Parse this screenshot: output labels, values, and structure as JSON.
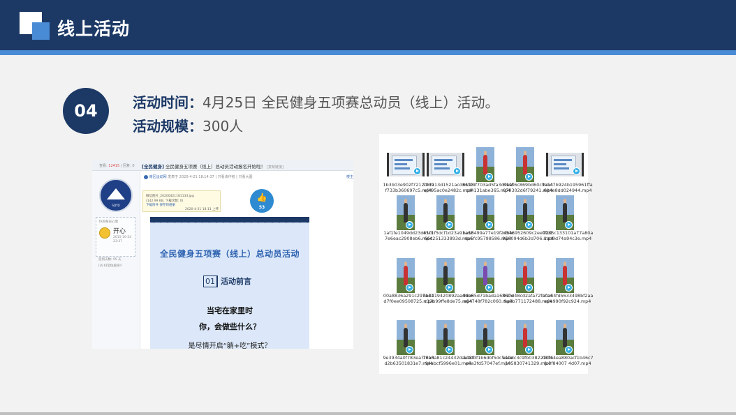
{
  "header": {
    "title": "线上活动"
  },
  "section": {
    "number": "04",
    "time_label": "活动时间：",
    "time_value": "4月25日  全民健身五项赛总动员（线上）活动。",
    "scale_label": "活动规模：",
    "scale_value": "300人"
  },
  "forum": {
    "stats_views_label": "查看:",
    "stats_views": "12415",
    "stats_replies": "| 回复: 0",
    "thread_tag": "[全民健身]",
    "thread_title": "全民健身五项赛（线上）总动员活动报名开始啦！",
    "thread_copy": "[复制链接]",
    "post_author": "南区运动网",
    "post_time": "发表于 2020-4-21 18:14:37",
    "post_links": "| 只看该作者 | 只看大图",
    "post_right": "楼主",
    "logo_text": "SQYD",
    "mood_title": "TA的每日心情",
    "mood_word": "开心",
    "mood_date": "2015-10-24 23:37",
    "stat1": "签到天数: 95 天",
    "stat2": "[LV.6]常住居民II",
    "attach_name": "微信图片_20200421181133.jpg",
    "attach_size": "(142.99 KB, 下载次数: 0)",
    "attach_links": "下载附件  保存到相册",
    "attach_time": "2020-4-21 18:11 上传",
    "like_icon": "👍",
    "like_count": "53",
    "poster_title": "全民健身五项赛（线上）总动员活动",
    "poster_section_num": "01",
    "poster_section": "活动前言",
    "poster_q1": "当宅在家里时",
    "poster_q2": "你，会做些什么？",
    "poster_q3": "是尽情开启“躺+吃”模式？"
  },
  "files": [
    {
      "name": "1b3b03e902f7212cf09f733b360697c5.mp4",
      "kind": "screen"
    },
    {
      "name": "7b3113d1521acd8613ef495ac0e2482c.mp4",
      "kind": "screen"
    },
    {
      "name": "61f0df703ad5fa3d7eafcd4131abe365.mp4",
      "kind": "red"
    },
    {
      "name": "84456c869bd60c9a54070302d6f79241.mp4",
      "kind": "red"
    },
    {
      "name": "fea47b924b195961ffa604e8dd024944.mp4",
      "kind": "screen"
    },
    {
      "name": "1af1fe1049dd23d61f97e6eac2908eb6.mp4",
      "kind": "dark"
    },
    {
      "name": "45c1f5dcf1d23a91a6b66c251333893d.mp4",
      "kind": "dark"
    },
    {
      "name": "ba18499a77e19f24bfeda5fc95798586.mp4",
      "kind": "dark"
    },
    {
      "name": "d546952609c2ee9fb1950094d6b3d706.mp4",
      "kind": "dark"
    },
    {
      "name": "ff285c133101a77a80a1dd9d74a94c3e.mp4",
      "kind": "dark"
    },
    {
      "name": "00a8836a291c297a41d7f0ee09508725.mp4",
      "kind": "red"
    },
    {
      "name": "0b3419420892aadbb6c12b99ffe8de75.mp4",
      "kind": "dark"
    },
    {
      "name": "94e85d71bada1686bea64748f782c060.mp4",
      "kind": "purple"
    },
    {
      "name": "917d48cd2afa72faca69a0b771172488.mp4",
      "kind": "red"
    },
    {
      "name": "c0a44fd5633498bf2aae0e990f92c924.mp4",
      "kind": "red"
    },
    {
      "name": "9e3934a0f783ea7f3bdd2b63501831e7.mp4",
      "kind": "dark"
    },
    {
      "name": "76a8a81c24432daeccf94abcf5996e01.mp4",
      "kind": "dark"
    },
    {
      "name": "148fdf1b6dbf5dc541ee6a3fd57047ef.mp4",
      "kind": "dark"
    },
    {
      "name": "aa4dc3c9fb0382210f6105830741329.mp4",
      "kind": "red"
    },
    {
      "name": "c80e4ea880acf1b46c7fc3f84007 4d07.mp4",
      "kind": "dark"
    }
  ],
  "colors": {
    "navy": "#1c3966",
    "accent": "#4a8bd6",
    "play": "#35b0e6"
  }
}
